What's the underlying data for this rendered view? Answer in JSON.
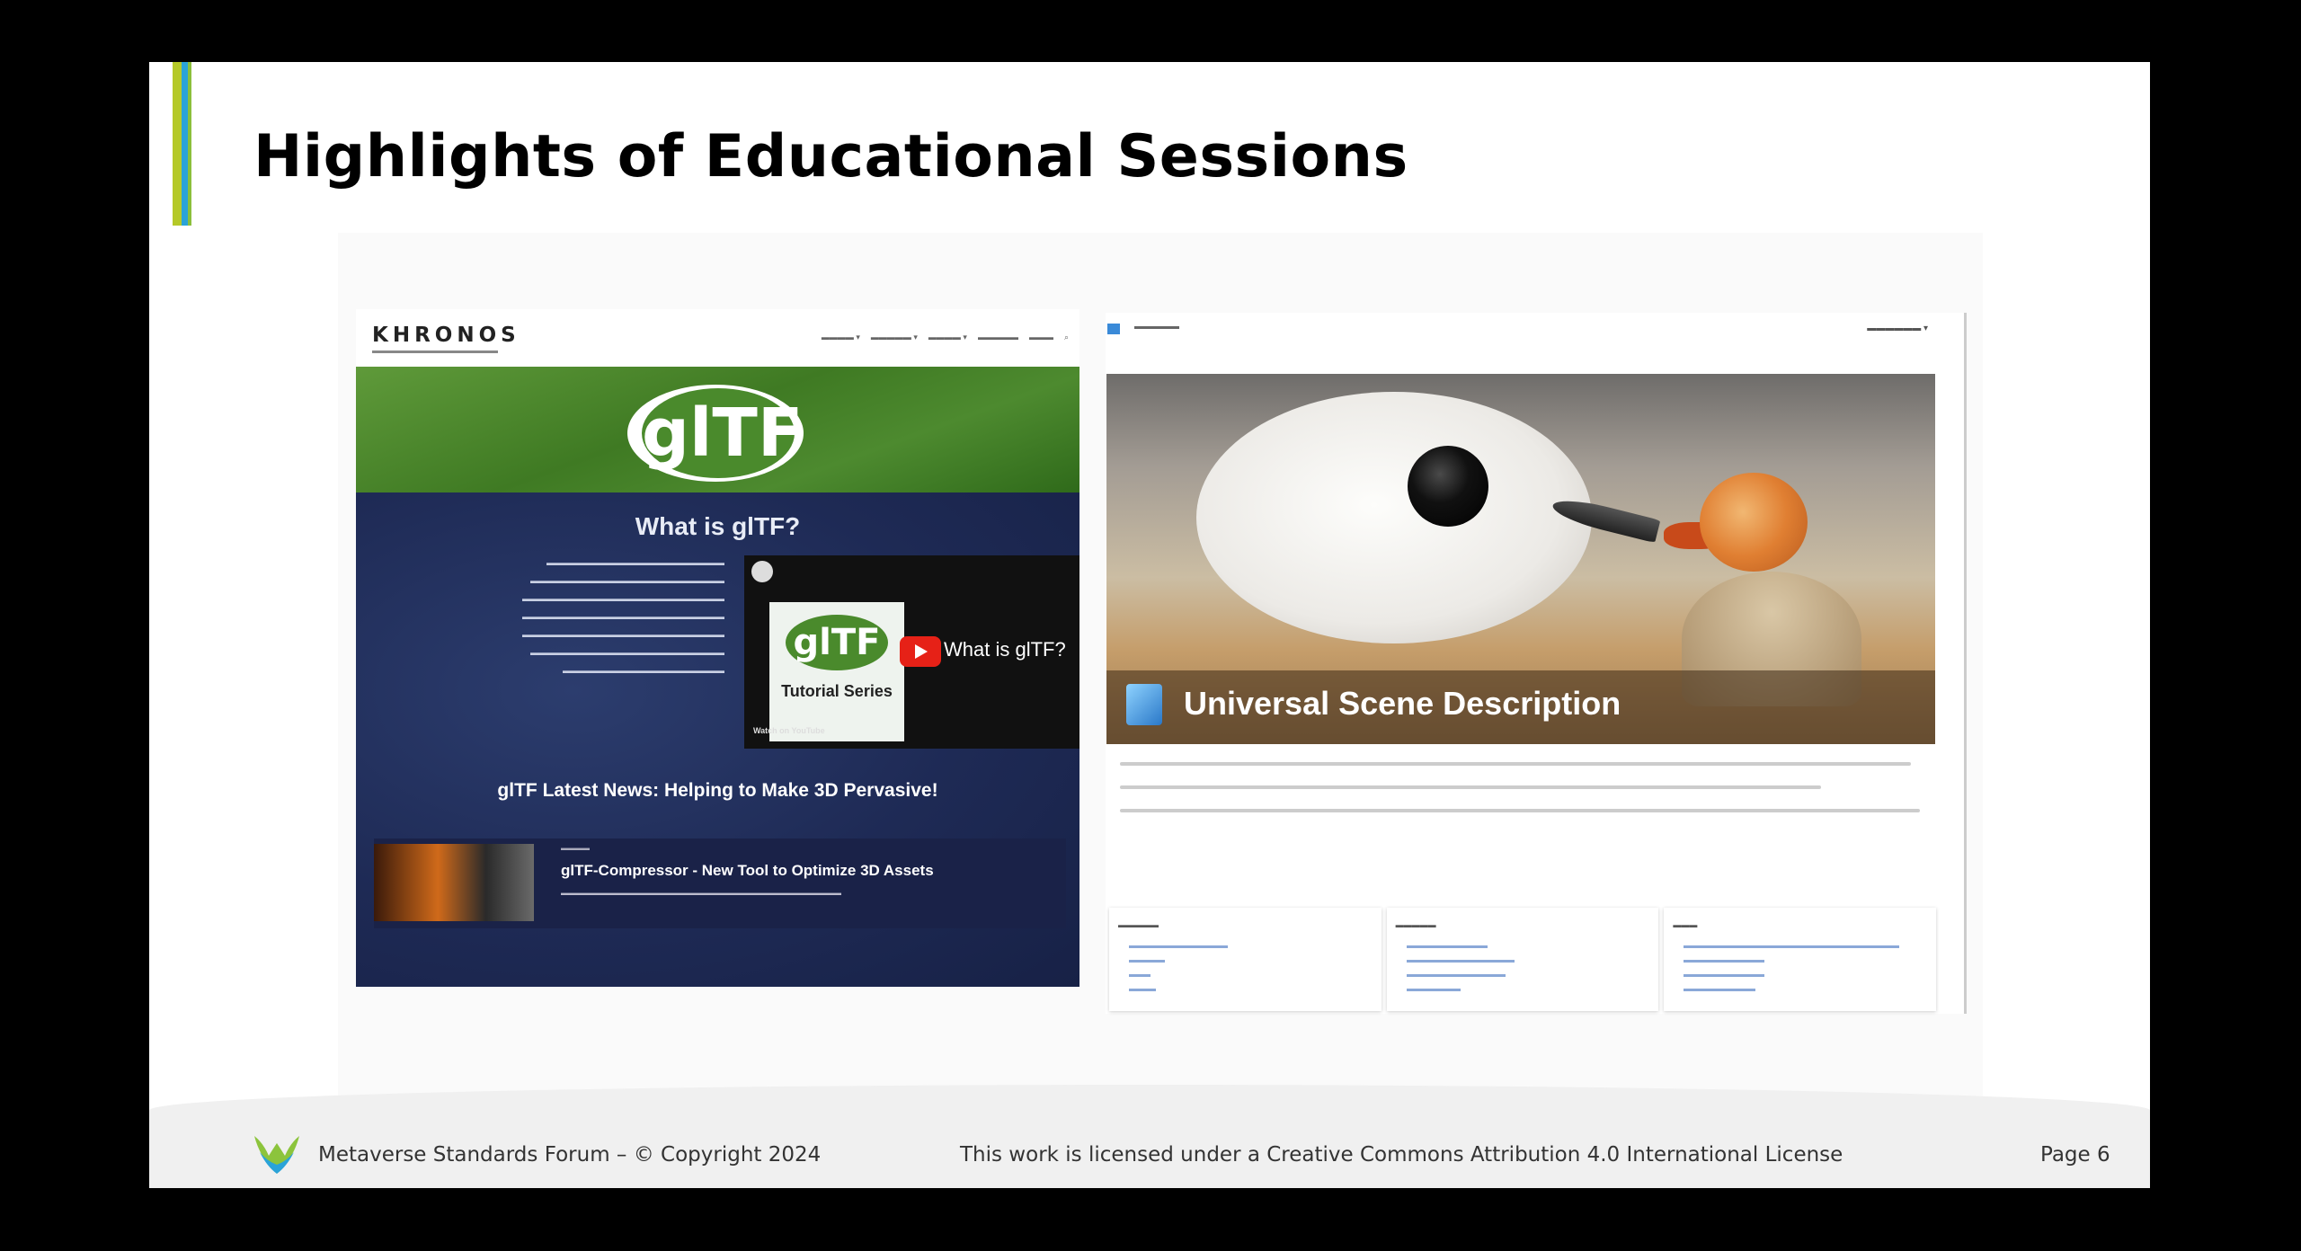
{
  "slide": {
    "title": "Highlights of Educational Sessions"
  },
  "gltf_site": {
    "brand": "KHRONOS",
    "logo": "glTF",
    "heading": "What is glTF?",
    "video": {
      "title": "What is glTF?",
      "thumb_text": "Tutorial Series",
      "watch_label": "Watch on YouTube"
    },
    "news_heading": "glTF Latest News: Helping to Make 3D Pervasive!",
    "news_item_title": "glTF-Compressor - New Tool to Optimize 3D Assets"
  },
  "usd_site": {
    "hero_title": "Universal Scene Description"
  },
  "footer": {
    "left": "Metaverse Standards Forum – © Copyright 2024",
    "center": "This work is licensed under a Creative Commons Attribution 4.0 International License",
    "page": "Page 6"
  },
  "colors": {
    "accent_green": "#b5c928",
    "accent_blue": "#2aa3d8",
    "gltf_navy": "#1e2a55",
    "gltf_green": "#4a8a2c"
  },
  "icons": {
    "youtube": "youtube-play-icon",
    "usd": "usd-cube-icon",
    "msf": "msf-logo-icon"
  }
}
